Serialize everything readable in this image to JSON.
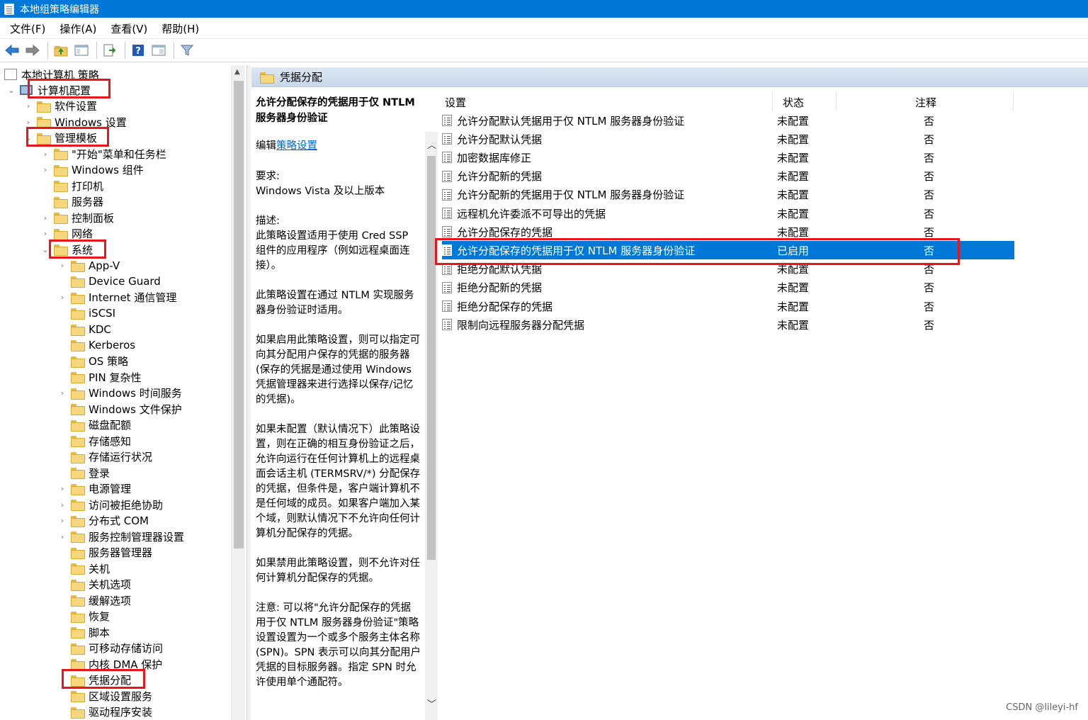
{
  "window": {
    "title": "本地组策略编辑器"
  },
  "menu": [
    "文件(F)",
    "操作(A)",
    "查看(V)",
    "帮助(H)"
  ],
  "toolbar_icons": [
    "back-arrow-icon",
    "forward-arrow-icon",
    "up-folder-icon",
    "show-hide-tree-icon",
    "export-list-icon",
    "help-icon",
    "properties-view-icon",
    "filter-icon"
  ],
  "tree": {
    "root": "本地计算机 策略",
    "items": [
      {
        "label": "计算机配置"
      },
      {
        "label": "软件设置"
      },
      {
        "label": "Windows 设置"
      },
      {
        "label": "管理模板"
      },
      {
        "label": "\"开始\"菜单和任务栏"
      },
      {
        "label": "Windows 组件"
      },
      {
        "label": "打印机"
      },
      {
        "label": "服务器"
      },
      {
        "label": "控制面板"
      },
      {
        "label": "网络"
      },
      {
        "label": "系统"
      },
      {
        "label": "App-V"
      },
      {
        "label": "Device Guard"
      },
      {
        "label": "Internet 通信管理"
      },
      {
        "label": "iSCSI"
      },
      {
        "label": "KDC"
      },
      {
        "label": "Kerberos"
      },
      {
        "label": "OS 策略"
      },
      {
        "label": "PIN 复杂性"
      },
      {
        "label": "Windows 时间服务"
      },
      {
        "label": "Windows 文件保护"
      },
      {
        "label": "磁盘配额"
      },
      {
        "label": "存储感知"
      },
      {
        "label": "存储运行状况"
      },
      {
        "label": "登录"
      },
      {
        "label": "电源管理"
      },
      {
        "label": "访问被拒绝协助"
      },
      {
        "label": "分布式 COM"
      },
      {
        "label": "服务控制管理器设置"
      },
      {
        "label": "服务器管理器"
      },
      {
        "label": "关机"
      },
      {
        "label": "关机选项"
      },
      {
        "label": "缓解选项"
      },
      {
        "label": "恢复"
      },
      {
        "label": "脚本"
      },
      {
        "label": "可移动存储访问"
      },
      {
        "label": "内核 DMA 保护"
      },
      {
        "label": "凭据分配"
      },
      {
        "label": "区域设置服务"
      },
      {
        "label": "驱动程序安装"
      }
    ]
  },
  "right_header": "凭据分配",
  "description": {
    "title": "允许分配保存的凭据用于仅 NTLM 服务器身份验证",
    "edit_prefix": "编辑",
    "edit_link": "策略设置",
    "requirement_label": "要求:",
    "requirement_value": "Windows Vista 及以上版本",
    "desc_label": "描述:",
    "para1": "此策略设置适用于使用 Cred SSP 组件的应用程序（例如远程桌面连接）。",
    "para2": "此策略设置在通过 NTLM 实现服务器身份验证时适用。",
    "para3": "如果启用此策略设置，则可以指定可向其分配用户保存的凭据的服务器(保存的凭据是通过使用 Windows 凭据管理器来进行选择以保存/记忆的凭据)。",
    "para4": "如果未配置（默认情况下）此策略设置，则在正确的相互身份验证之后，允许向运行在任何计算机上的远程桌面会话主机 (TERMSRV/*) 分配保存的凭据，但条件是，客户端计算机不是任何域的成员。如果客户端加入某个域，则默认情况下不允许向任何计算机分配保存的凭据。",
    "para5": "如果禁用此策略设置，则不允许对任何计算机分配保存的凭据。",
    "para6": "注意: 可以将\"允许分配保存的凭据用于仅 NTLM 服务器身份验证\"策略设置设置为一个或多个服务主体名称(SPN)。SPN 表示可以向其分配用户凭据的目标服务器。指定 SPN 时允许使用单个通配符。"
  },
  "list": {
    "columns": {
      "setting": "设置",
      "state": "状态",
      "note": "注释"
    },
    "rows": [
      {
        "name": "允许分配默认凭据用于仅 NTLM 服务器身份验证",
        "state": "未配置",
        "note": "否"
      },
      {
        "name": "允许分配默认凭据",
        "state": "未配置",
        "note": "否"
      },
      {
        "name": "加密数据库修正",
        "state": "未配置",
        "note": "否"
      },
      {
        "name": "允许分配新的凭据",
        "state": "未配置",
        "note": "否"
      },
      {
        "name": "允许分配新的凭据用于仅 NTLM 服务器身份验证",
        "state": "未配置",
        "note": "否"
      },
      {
        "name": "远程机允许委派不可导出的凭据",
        "state": "未配置",
        "note": "否"
      },
      {
        "name": "允许分配保存的凭据",
        "state": "未配置",
        "note": "否"
      },
      {
        "name": "允许分配保存的凭据用于仅 NTLM 服务器身份验证",
        "state": "已启用",
        "note": "否"
      },
      {
        "name": "拒绝分配默认凭据",
        "state": "未配置",
        "note": "否"
      },
      {
        "name": "拒绝分配新的凭据",
        "state": "未配置",
        "note": "否"
      },
      {
        "name": "拒绝分配保存的凭据",
        "state": "未配置",
        "note": "否"
      },
      {
        "name": "限制向远程服务器分配凭据",
        "state": "未配置",
        "note": "否"
      }
    ]
  },
  "watermark": "CSDN @lileyi-hf",
  "colors": {
    "titlebar": "#0078d7",
    "selection": "#0078d7",
    "highlight_box": "#e8151b",
    "link": "#0066cc"
  }
}
